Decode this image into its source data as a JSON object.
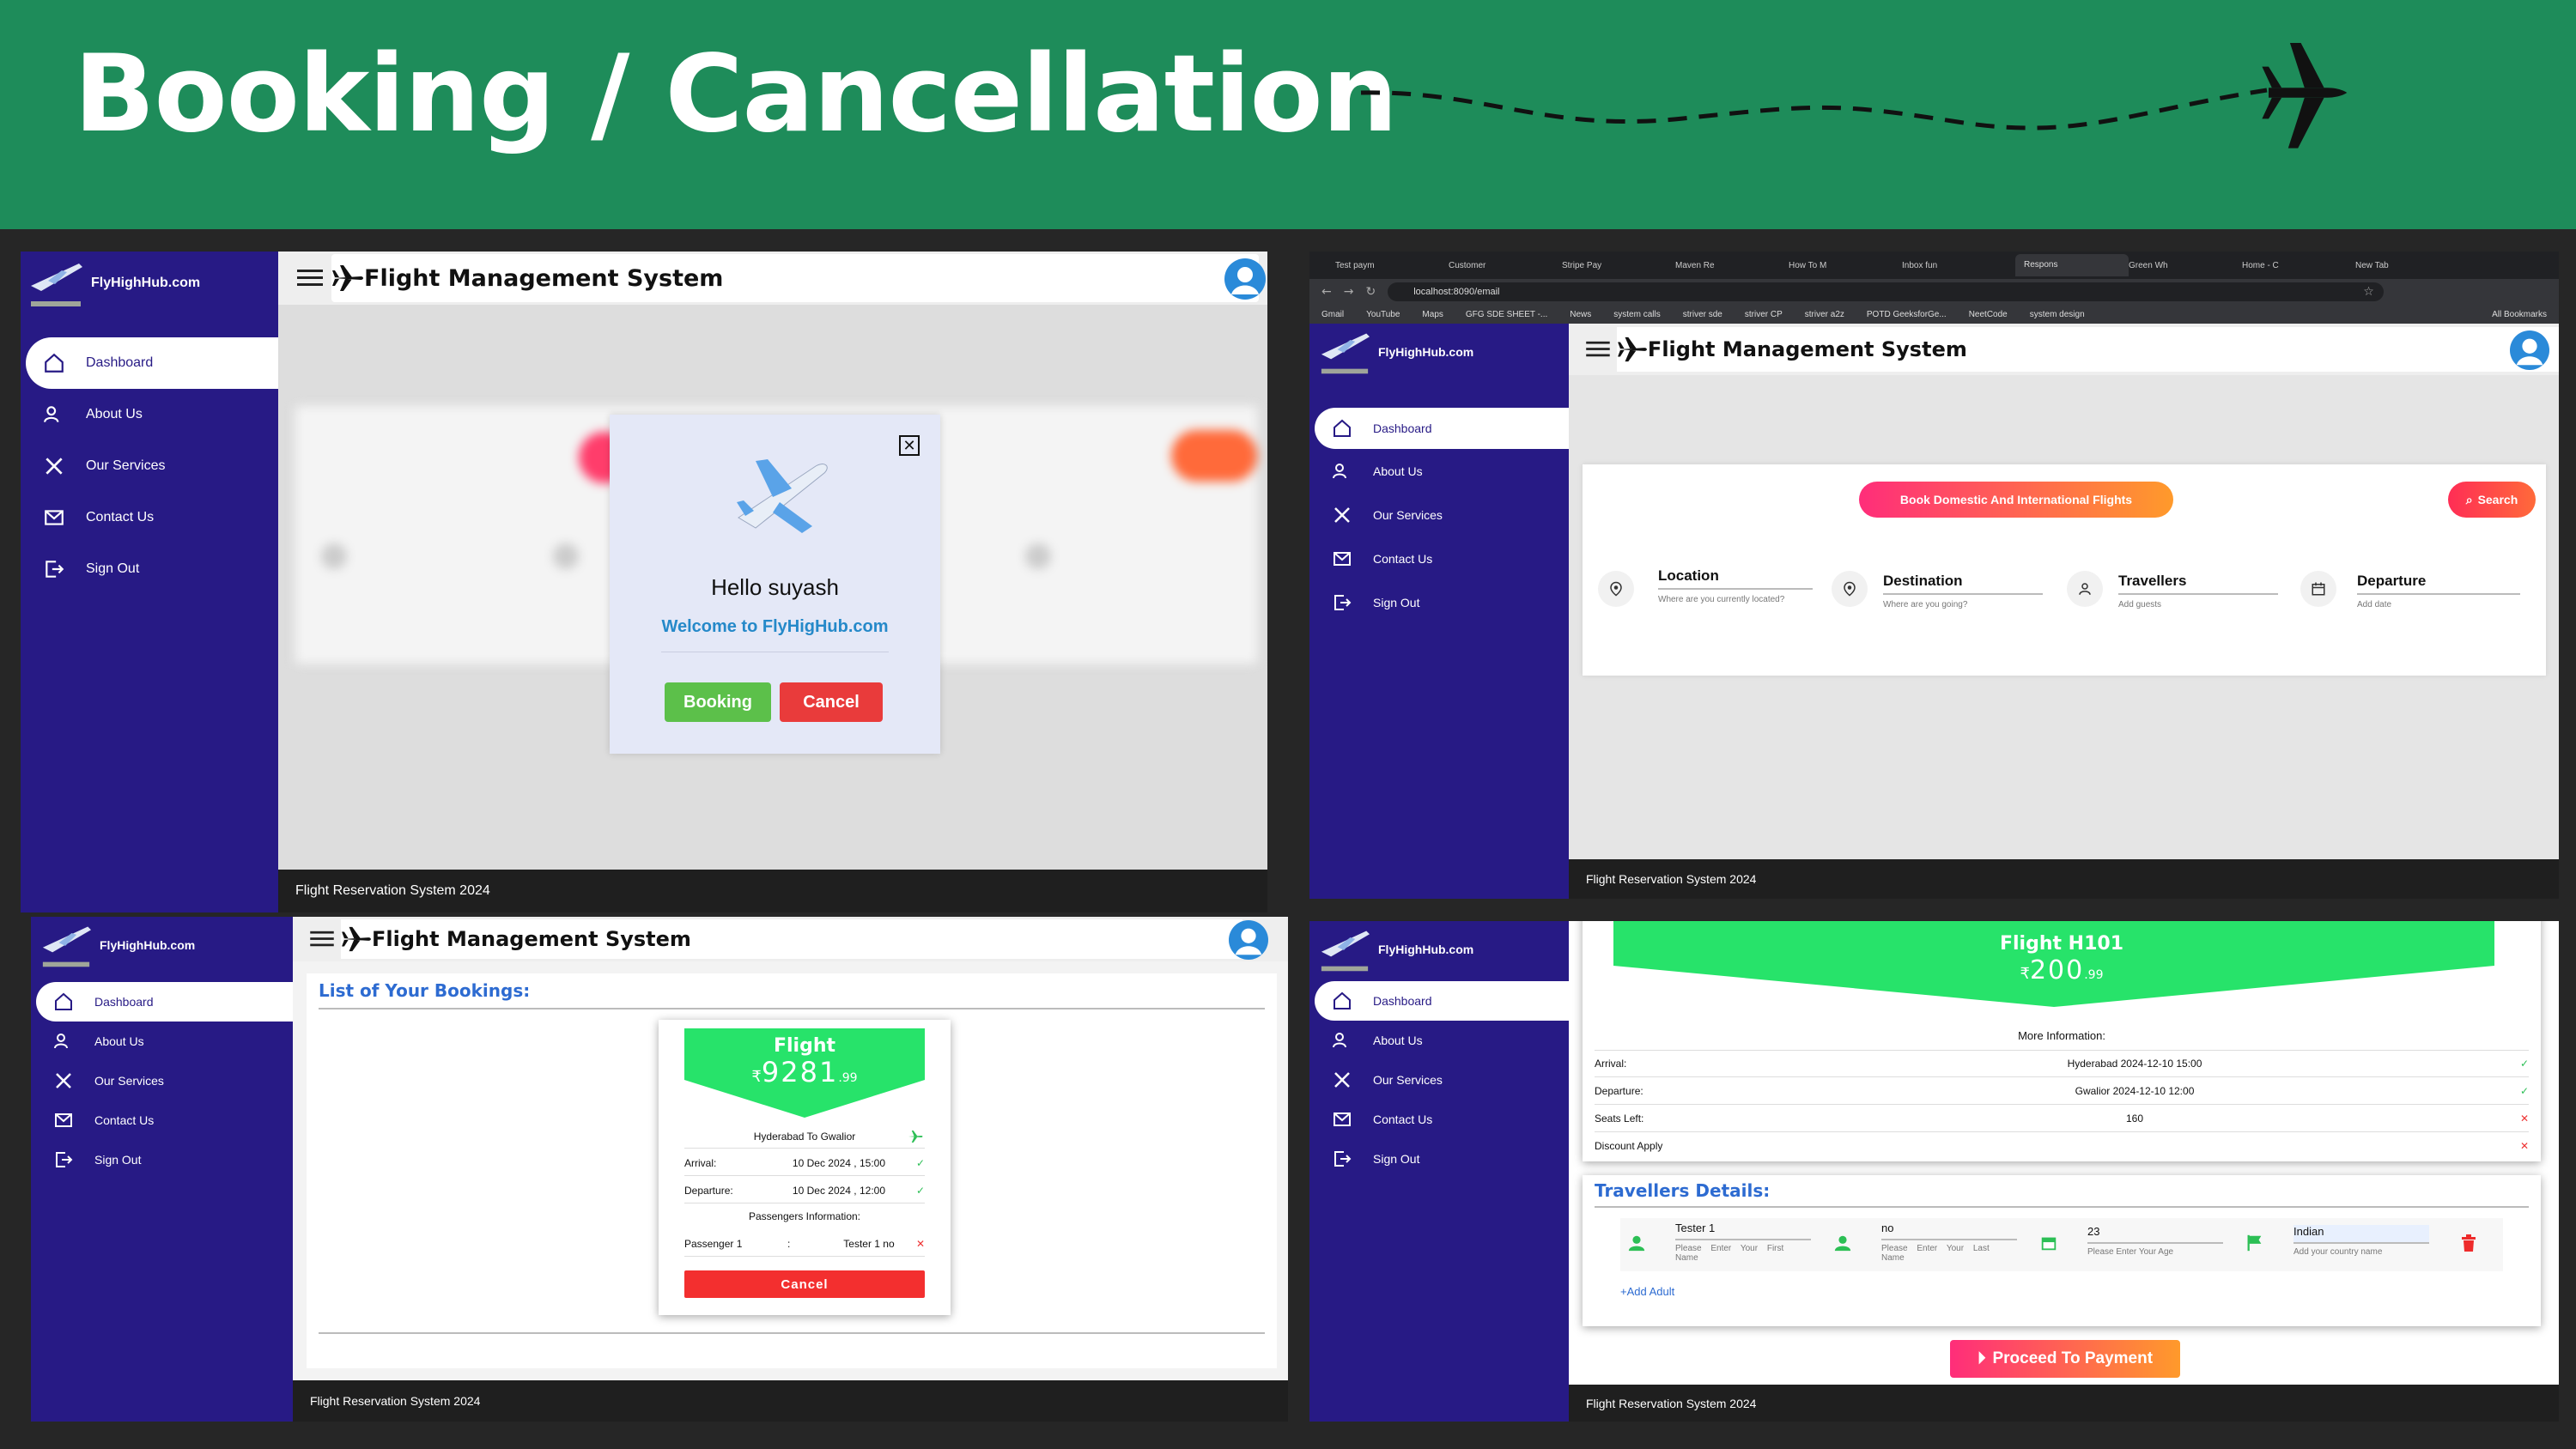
{
  "banner": {
    "title": "Booking / Cancellation",
    "bg": "#1e8c5a"
  },
  "brand": "FlyHighHub.com",
  "app_title": "Flight Management System",
  "footer": "Flight Reservation System 2024",
  "nav": [
    "Dashboard",
    "About Us",
    "Our Services",
    "Contact Us",
    "Sign Out"
  ],
  "modal": {
    "greeting": "Hello suyash",
    "welcome": "Welcome to FlyHigHub.com",
    "booking": "Booking",
    "cancel": "Cancel"
  },
  "browser": {
    "tabs": [
      "Test paym",
      "Customer",
      "Stripe Pay",
      "Maven Re",
      "How To M",
      "Inbox fun",
      "Respons",
      "Green Wh",
      "Home - C",
      "New Tab"
    ],
    "url": "localhost:8090/email",
    "bookmarks": [
      "Gmail",
      "YouTube",
      "Maps",
      "GFG SDE SHEET -...",
      "News",
      "system calls",
      "striver sde",
      "striver CP",
      "striver a2z",
      "POTD GeeksforGe...",
      "NeetCode",
      "system design"
    ],
    "all_bookmarks": "All Bookmarks"
  },
  "search": {
    "book_btn": "Book Domestic And International Flights",
    "search_btn": "Search",
    "fields": [
      {
        "label": "Location",
        "hint": "Where are you currently located?"
      },
      {
        "label": "Destination",
        "hint": "Where are you going?"
      },
      {
        "label": "Travellers",
        "hint": "Add guests"
      },
      {
        "label": "Departure",
        "hint": "Add date"
      }
    ]
  },
  "bookings": {
    "heading": "List of Your Bookings:",
    "flight": "Flight",
    "currency": "₹",
    "price": "9281",
    "cents": ".99",
    "route": "Hyderabad To Gwalior",
    "arrival_label": "Arrival:",
    "arrival": "10 Dec 2024 , 15:00",
    "departure_label": "Departure:",
    "departure": "10 Dec 2024 , 12:00",
    "passengers_title": "Passengers Information:",
    "passenger_label": "Passenger 1",
    "passenger_sep": ":",
    "passenger_value": "Tester 1 no",
    "cancel": "Cancel"
  },
  "details": {
    "flight": "Flight H101",
    "currency": "₹",
    "price": "200",
    "cents": ".99",
    "more": "More Information:",
    "rows": [
      {
        "label": "Arrival:",
        "value": "Hyderabad 2024-12-10 15:00"
      },
      {
        "label": "Departure:",
        "value": "Gwalior 2024-12-10 12:00"
      },
      {
        "label": "Seats Left:",
        "value": "160"
      },
      {
        "label": "Discount Apply",
        "value": ""
      }
    ],
    "travellers_heading": "Travellers Details:",
    "traveller": {
      "first_value": "Tester 1",
      "first_ph": "Please Enter Your First Name",
      "last_value": "no",
      "last_ph": "Please Enter Your Last Name",
      "age_value": "23",
      "age_ph": "Please Enter Your Age",
      "country_value": "Indian",
      "country_ph": "Add your country name"
    },
    "add_adult": "+Add Adult",
    "proceed": "Proceed To Payment"
  }
}
